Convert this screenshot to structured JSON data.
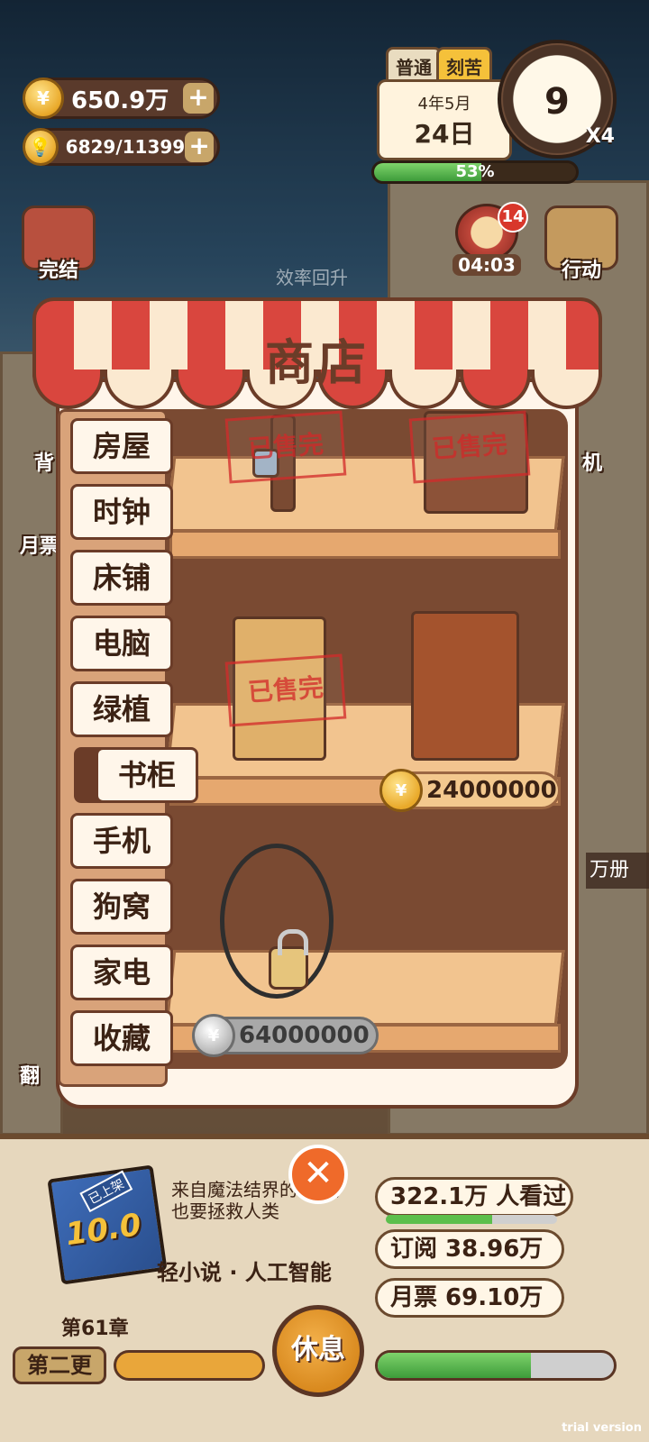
{
  "currency": {
    "coins": "650.9万",
    "inspiration": "6829/11399"
  },
  "date": {
    "difficulty_tabs": [
      "普通",
      "刻苦"
    ],
    "year_month": "4年5月",
    "day": "24日",
    "hour": "9",
    "speed": "X4",
    "energy_percent_label": "53%",
    "energy_value": 0.53
  },
  "side_buttons": {
    "finish": "完结",
    "action": "行动",
    "timer": "04:03",
    "timer_badge": "14",
    "bag": "背",
    "monthly": "月票",
    "phone": "机",
    "flip": "翻",
    "volumes": "万册"
  },
  "faint_hint": "效率回升",
  "shop": {
    "title": "商店",
    "tabs": [
      "房屋",
      "时钟",
      "床铺",
      "电脑",
      "绿植",
      "书柜",
      "手机",
      "狗窝",
      "家电",
      "收藏"
    ],
    "active_tab": "书柜",
    "sold_label": "已售完",
    "items": [
      {
        "name": "bookshelf-stand",
        "status": "sold"
      },
      {
        "name": "wooden-cabinet",
        "status": "sold"
      },
      {
        "name": "light-bookcase",
        "status": "sold"
      },
      {
        "name": "glass-bookcase",
        "status": "buy",
        "price": "24000000",
        "currency": "gold"
      },
      {
        "name": "round-shelf",
        "status": "locked",
        "price": "64000000",
        "currency": "silver"
      }
    ]
  },
  "book": {
    "cover_tag": "已上架",
    "score": "10.0",
    "description": "来自魔法结界的 今天也要拯救人类",
    "genre": "轻小说 · 人工智能",
    "readers": "322.1万 人看过",
    "readers_progress": 0.62,
    "subscriptions": "订阅 38.96万",
    "monthly_votes": "月票 69.10万",
    "chapter": "第61章",
    "second_update": "第二更",
    "rest_button": "休息",
    "writing_progress": 0.65
  },
  "watermark": "trial version",
  "colors": {
    "awning_red": "#d9463e",
    "wood_dark": "#6b3c28",
    "gold": "#e9a92a",
    "green": "#3d9c3a"
  }
}
